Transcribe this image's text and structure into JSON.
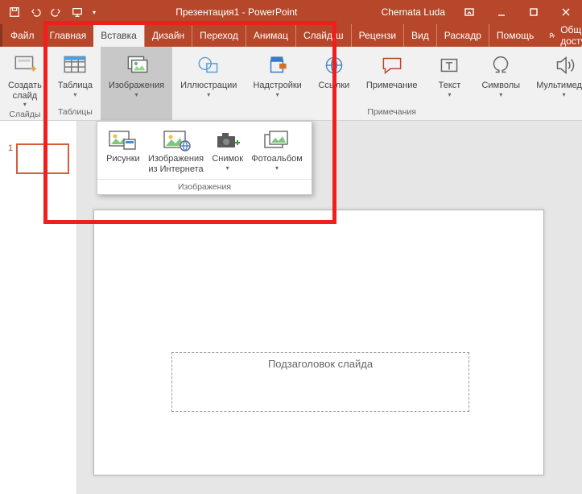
{
  "titlebar": {
    "doc_title": "Презентация1 - PowerPoint",
    "user": "Chernata Luda"
  },
  "tabs": {
    "file": "Файл",
    "items": [
      "Главная",
      "Вставка",
      "Дизайн",
      "Переход",
      "Анимац",
      "Слайд-ш",
      "Рецензи",
      "Вид",
      "Раскадр"
    ],
    "active_index": 1,
    "help": "Помощь",
    "share": "Общий доступ"
  },
  "ribbon": {
    "groups": {
      "slides": {
        "btn": "Создать\nслайд",
        "label": "Слайды"
      },
      "tables": {
        "btn": "Таблица",
        "label": "Таблицы"
      },
      "images": {
        "btn": "Изображения"
      },
      "illustr": {
        "btn": "Иллюстрации"
      },
      "addins": {
        "btn": "Надстройки"
      },
      "links": {
        "btn": "Ссылки"
      },
      "comment": {
        "btn": "Примечание",
        "label": "Примечания"
      },
      "text": {
        "btn": "Текст"
      },
      "symbols": {
        "btn": "Символы"
      },
      "media": {
        "btn": "Мультимедиа"
      }
    }
  },
  "gallery": {
    "items": [
      "Рисунки",
      "Изображения\nиз Интернета",
      "Снимок",
      "Фотоальбом"
    ],
    "footer": "Изображения"
  },
  "thumbs": {
    "first_num": "1"
  },
  "slide": {
    "subtitle_placeholder": "Подзаголовок слайда"
  }
}
